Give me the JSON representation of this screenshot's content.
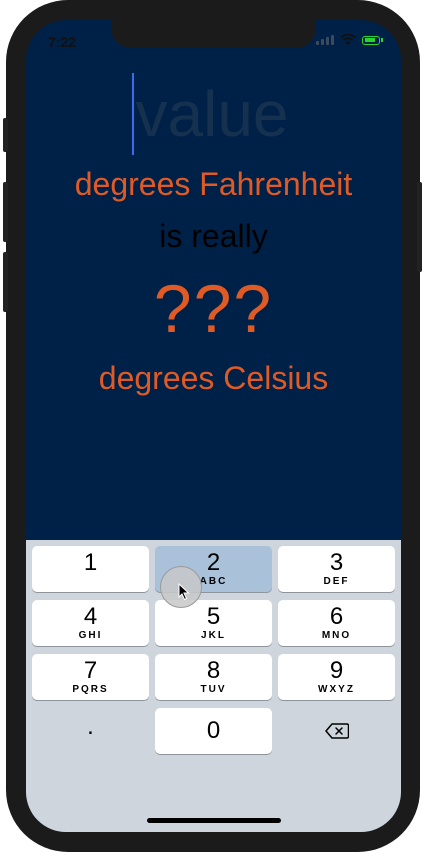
{
  "status_bar": {
    "time": "7:22",
    "wifi_icon": "wifi-icon",
    "battery_icon": "battery-charging-icon"
  },
  "colors": {
    "background": "#002147",
    "accent": "#E05A26",
    "text_dark": "#000000",
    "keyboard": "#CFD5DD"
  },
  "converter": {
    "input_value": "",
    "input_placeholder": "value",
    "from_unit": "degrees Fahrenheit",
    "connector": "is really",
    "result": "???",
    "to_unit": "degrees Celsius"
  },
  "keypad": {
    "keys": [
      {
        "number": "1",
        "letters": ""
      },
      {
        "number": "2",
        "letters": "ABC",
        "pressed": true
      },
      {
        "number": "3",
        "letters": "DEF"
      },
      {
        "number": "4",
        "letters": "GHI"
      },
      {
        "number": "5",
        "letters": "JKL"
      },
      {
        "number": "6",
        "letters": "MNO"
      },
      {
        "number": "7",
        "letters": "PQRS"
      },
      {
        "number": "8",
        "letters": "TUV"
      },
      {
        "number": "9",
        "letters": "WXYZ"
      },
      {
        "number": ".",
        "letters": ""
      },
      {
        "number": "0",
        "letters": ""
      }
    ],
    "backspace_icon": "backspace-icon"
  }
}
